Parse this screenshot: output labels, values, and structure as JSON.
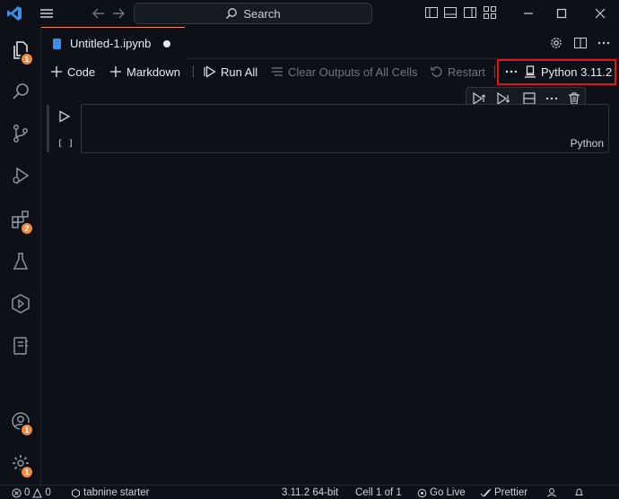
{
  "window": {
    "search_label": "Search",
    "icons": [
      "vscode-logo-icon",
      "menu-icon",
      "back-arrow-icon",
      "forward-arrow-icon",
      "search-icon",
      "layout-icons",
      "minimize-icon",
      "maximize-icon",
      "close-icon"
    ]
  },
  "activity_bar": {
    "items": [
      {
        "name": "explorer",
        "badge": "1"
      },
      {
        "name": "search",
        "badge": ""
      },
      {
        "name": "source-control",
        "badge": ""
      },
      {
        "name": "run-debug",
        "badge": ""
      },
      {
        "name": "extensions",
        "badge": "2"
      },
      {
        "name": "testing",
        "badge": ""
      },
      {
        "name": "remote",
        "badge": ""
      },
      {
        "name": "notebook",
        "badge": ""
      }
    ],
    "accounts_badge": "1",
    "settings_badge": "1"
  },
  "editor": {
    "tab_title": "Untitled-1.ipynb"
  },
  "notebook_toolbar": {
    "code_label": "Code",
    "markdown_label": "Markdown",
    "run_all_label": "Run All",
    "clear_outputs_label": "Clear Outputs of All Cells",
    "restart_label": "Restart",
    "kernel_label": "Python 3.11.2"
  },
  "cell": {
    "execution_count": "[ ]",
    "language": "Python"
  },
  "status_bar": {
    "errors": "0",
    "warnings": "0",
    "tabnine": "tabnine starter",
    "python_version": "3.11.2 64-bit",
    "cell_position": "Cell 1 of 1",
    "go_live": "Go Live",
    "prettier": "Prettier"
  },
  "colors": {
    "background": "#0d1117",
    "badge": "#f0883e",
    "highlight_box": "#e0141a"
  }
}
